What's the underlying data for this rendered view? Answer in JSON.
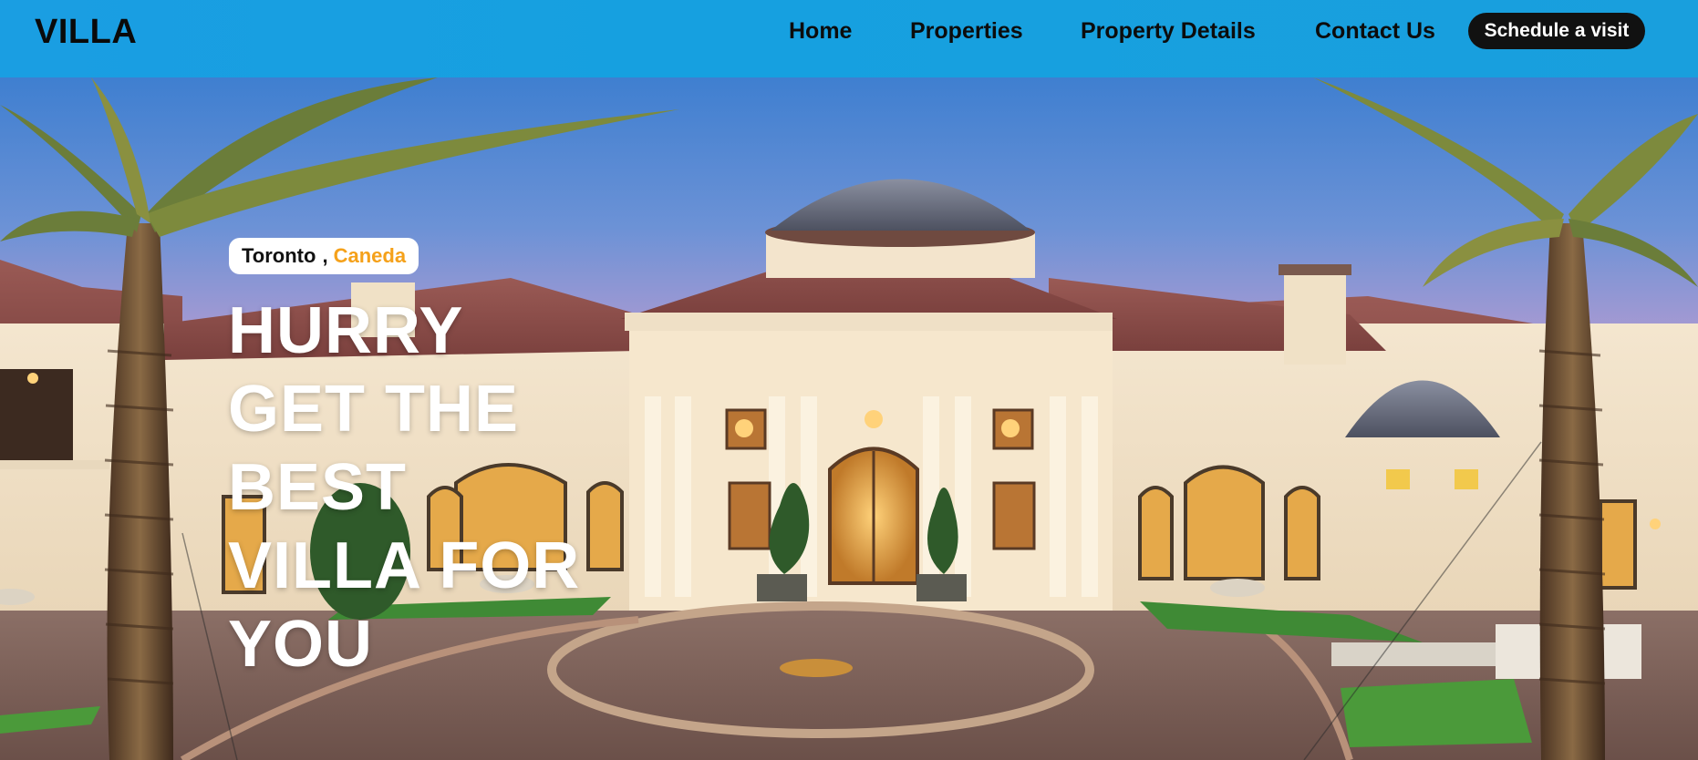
{
  "header": {
    "logo": "VILLA",
    "nav": {
      "home": "Home",
      "properties": "Properties",
      "property_details": "Property Details",
      "contact": "Contact Us"
    },
    "cta_label": "Schedule a visit"
  },
  "hero": {
    "location": {
      "city": "Toronto",
      "separator": ",",
      "country": "Caneda"
    },
    "headline": "HURRY GET THE BEST VILLA FOR YOU"
  },
  "colors": {
    "header_bg": "#1a9ee2",
    "accent": "#f5a11a",
    "cta_bg": "#111111"
  }
}
